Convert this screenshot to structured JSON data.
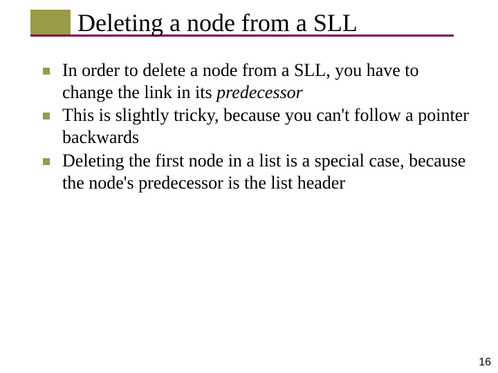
{
  "title": "Deleting a node from a SLL",
  "bullets": [
    {
      "pre": "In order to delete a node from a SLL, you have to change the link in its ",
      "em": "predecessor",
      "post": ""
    },
    {
      "pre": "This is slightly tricky, because you can't follow a pointer backwards",
      "em": "",
      "post": ""
    },
    {
      "pre": "Deleting the first node in a list is a special case, because the node's predecessor is the list header",
      "em": "",
      "post": ""
    }
  ],
  "page_number": "16"
}
